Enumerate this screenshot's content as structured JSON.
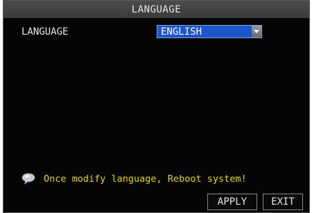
{
  "window": {
    "title": "LANGUAGE"
  },
  "form": {
    "language_label": "LANGUAGE",
    "language_value": "ENGLISH"
  },
  "notice": {
    "icon": "speech-bubble-icon",
    "text": "Once modify language, Reboot system!",
    "color": "#e8d800"
  },
  "buttons": {
    "apply": "APPLY",
    "exit": "EXIT"
  },
  "colors": {
    "background": "#050505",
    "select_highlight": "#1c56c8"
  }
}
